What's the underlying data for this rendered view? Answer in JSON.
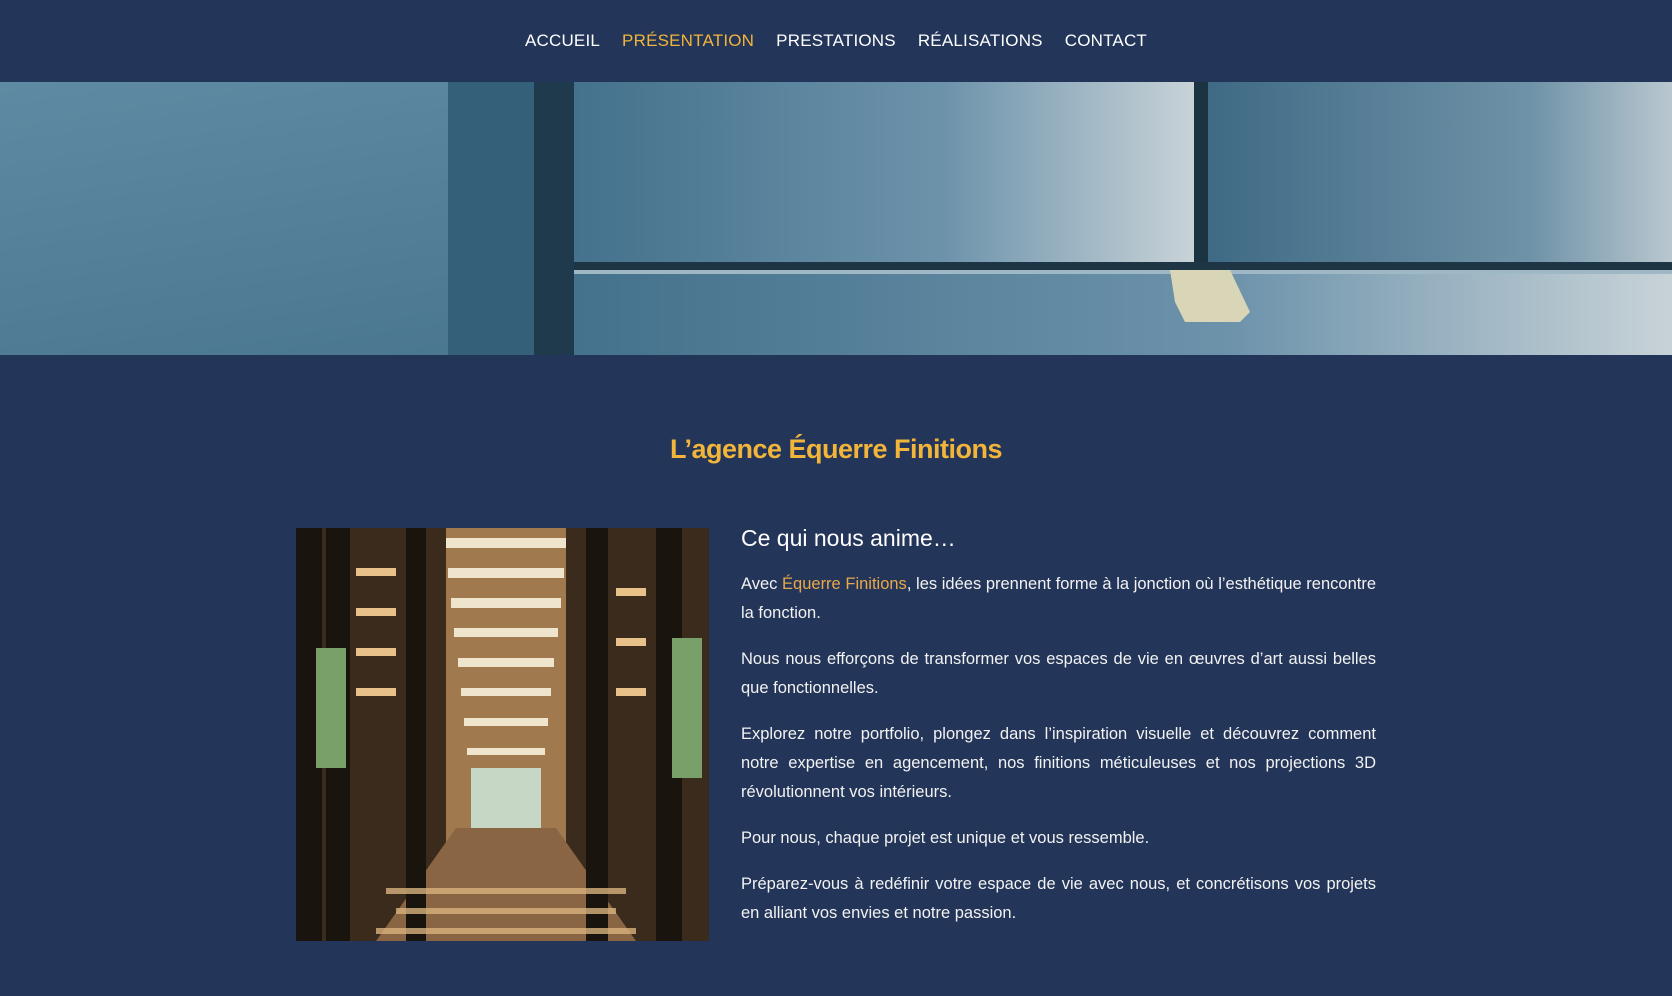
{
  "nav": {
    "items": [
      {
        "label": "ACCUEIL",
        "active": false
      },
      {
        "label": "PRÉSENTATION",
        "active": true
      },
      {
        "label": "PRESTATIONS",
        "active": false
      },
      {
        "label": "RÉALISATIONS",
        "active": false
      },
      {
        "label": "CONTACT",
        "active": false
      }
    ]
  },
  "colors": {
    "background": "#233558",
    "accent": "#f2b53b",
    "link": "#e9a84a",
    "text": "#ffffff"
  },
  "main": {
    "title": "L’agence Équerre Finitions",
    "subtitle": "Ce qui nous anime…",
    "intro": {
      "before": "Avec ",
      "brand": "Équerre Finitions",
      "after": ", les idées prennent forme à la jonction où l’esthétique rencontre la fonction."
    },
    "paragraphs": [
      "Nous nous efforçons de transformer vos espaces de vie en œuvres d’art aussi belles que fonctionnelles.",
      "Explorez notre portfolio, plongez dans l’inspiration visuelle et découvrez comment notre expertise en agencement, nos finitions méticuleuses et nos projections 3D révolutionnent vos intérieurs.",
      "Pour nous, chaque projet est unique et vous ressemble.",
      "Préparez-vous à redéfinir votre espace de vie avec nous, et concrétisons vos projets en alliant vos envies et notre passion."
    ]
  }
}
